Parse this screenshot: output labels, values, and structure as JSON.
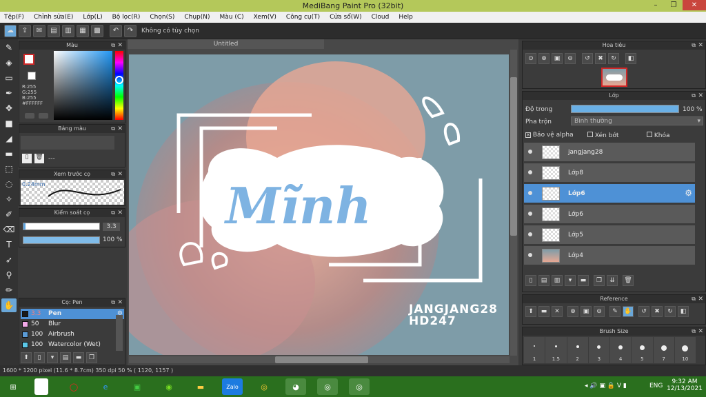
{
  "app": {
    "title": "MediBang Paint Pro (32bit)"
  },
  "menu": [
    "Tệp(F)",
    "Chỉnh sửa(E)",
    "Lớp(L)",
    "Bộ lọc(R)",
    "Chọn(S)",
    "Chụp(N)",
    "Màu (C)",
    "Xem(V)",
    "Công cụ(T)",
    "Cửa sổ(W)",
    "Cloud",
    "Help"
  ],
  "toolbar": {
    "option_text": "Không có tùy chọn"
  },
  "color_panel": {
    "title": "Màu",
    "r": "R:255",
    "g": "G:255",
    "b": "B:255",
    "hex": "#FFFFFF"
  },
  "palette_panel": {
    "title": "Bảng màu",
    "dashes": "---"
  },
  "brush_preview": {
    "title": "Xem trước cọ",
    "size": "0.24mm"
  },
  "brush_control": {
    "title": "Kiểm soát cọ",
    "size_value": "3.3",
    "opacity_value": "100 %"
  },
  "brush_list": {
    "title": "Cọ: Pen",
    "items": [
      {
        "size": "3.3",
        "name": "Pen",
        "color": "#1a1a1a"
      },
      {
        "size": "50",
        "name": "Blur",
        "color": "#f1a9e8"
      },
      {
        "size": "100",
        "name": "Airbrush",
        "color": "#5b9bd5"
      },
      {
        "size": "100",
        "name": "Watercolor (Wet)",
        "color": "#5bc8e8"
      }
    ]
  },
  "document": {
    "tab": "Untitled",
    "line1": "JANGJANG28",
    "line2": "HD247"
  },
  "navigator": {
    "title": "Hoa tiêu"
  },
  "layers": {
    "title": "Lớp",
    "opacity_label": "Độ trong",
    "opacity_value": "100 %",
    "blend_label": "Pha trộn",
    "blend_value": "Bình thường",
    "protect_alpha": "Bảo vệ alpha",
    "clipping": "Xén bớt",
    "lock": "Khóa",
    "items": [
      "jangjang28",
      "Lớp8",
      "Lớp6",
      "Lớp6",
      "Lớp5",
      "Lớp4"
    ]
  },
  "reference": {
    "title": "Reference"
  },
  "brush_size": {
    "title": "Brush Size",
    "values": [
      "1",
      "1.5",
      "2",
      "3",
      "4",
      "5",
      "7",
      "10"
    ]
  },
  "status": {
    "text": "1600 * 1200 pixel  (11.6 * 8.7cm)  350 dpi  50 %  ( 1120, 1157 )"
  },
  "taskbar": {
    "time": "9:32 AM",
    "date": "12/13/2021",
    "lang": "ENG"
  }
}
